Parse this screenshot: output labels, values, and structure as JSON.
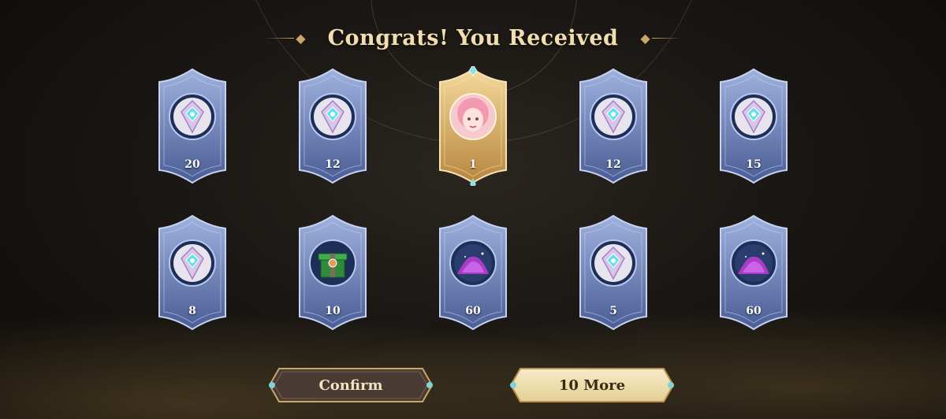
{
  "title": "Congrats! You Received",
  "rewards": [
    {
      "type": "silver-ticket",
      "quantity": "20"
    },
    {
      "type": "silver-ticket",
      "quantity": "12"
    },
    {
      "type": "hero-portrait",
      "quantity": "1"
    },
    {
      "type": "silver-ticket",
      "quantity": "12"
    },
    {
      "type": "silver-ticket",
      "quantity": "15"
    },
    {
      "type": "silver-ticket",
      "quantity": "8"
    },
    {
      "type": "green-gift-box",
      "quantity": "10"
    },
    {
      "type": "magic-dust",
      "quantity": "60"
    },
    {
      "type": "silver-ticket",
      "quantity": "5"
    },
    {
      "type": "magic-dust",
      "quantity": "60"
    }
  ],
  "buttons": {
    "confirm": "Confirm",
    "more": "10 More"
  },
  "colors": {
    "title": "#f1ddb0",
    "card_blue": "#7f94c9",
    "card_gold": "#d9b36a",
    "button_gold": "#f0e1b1"
  }
}
